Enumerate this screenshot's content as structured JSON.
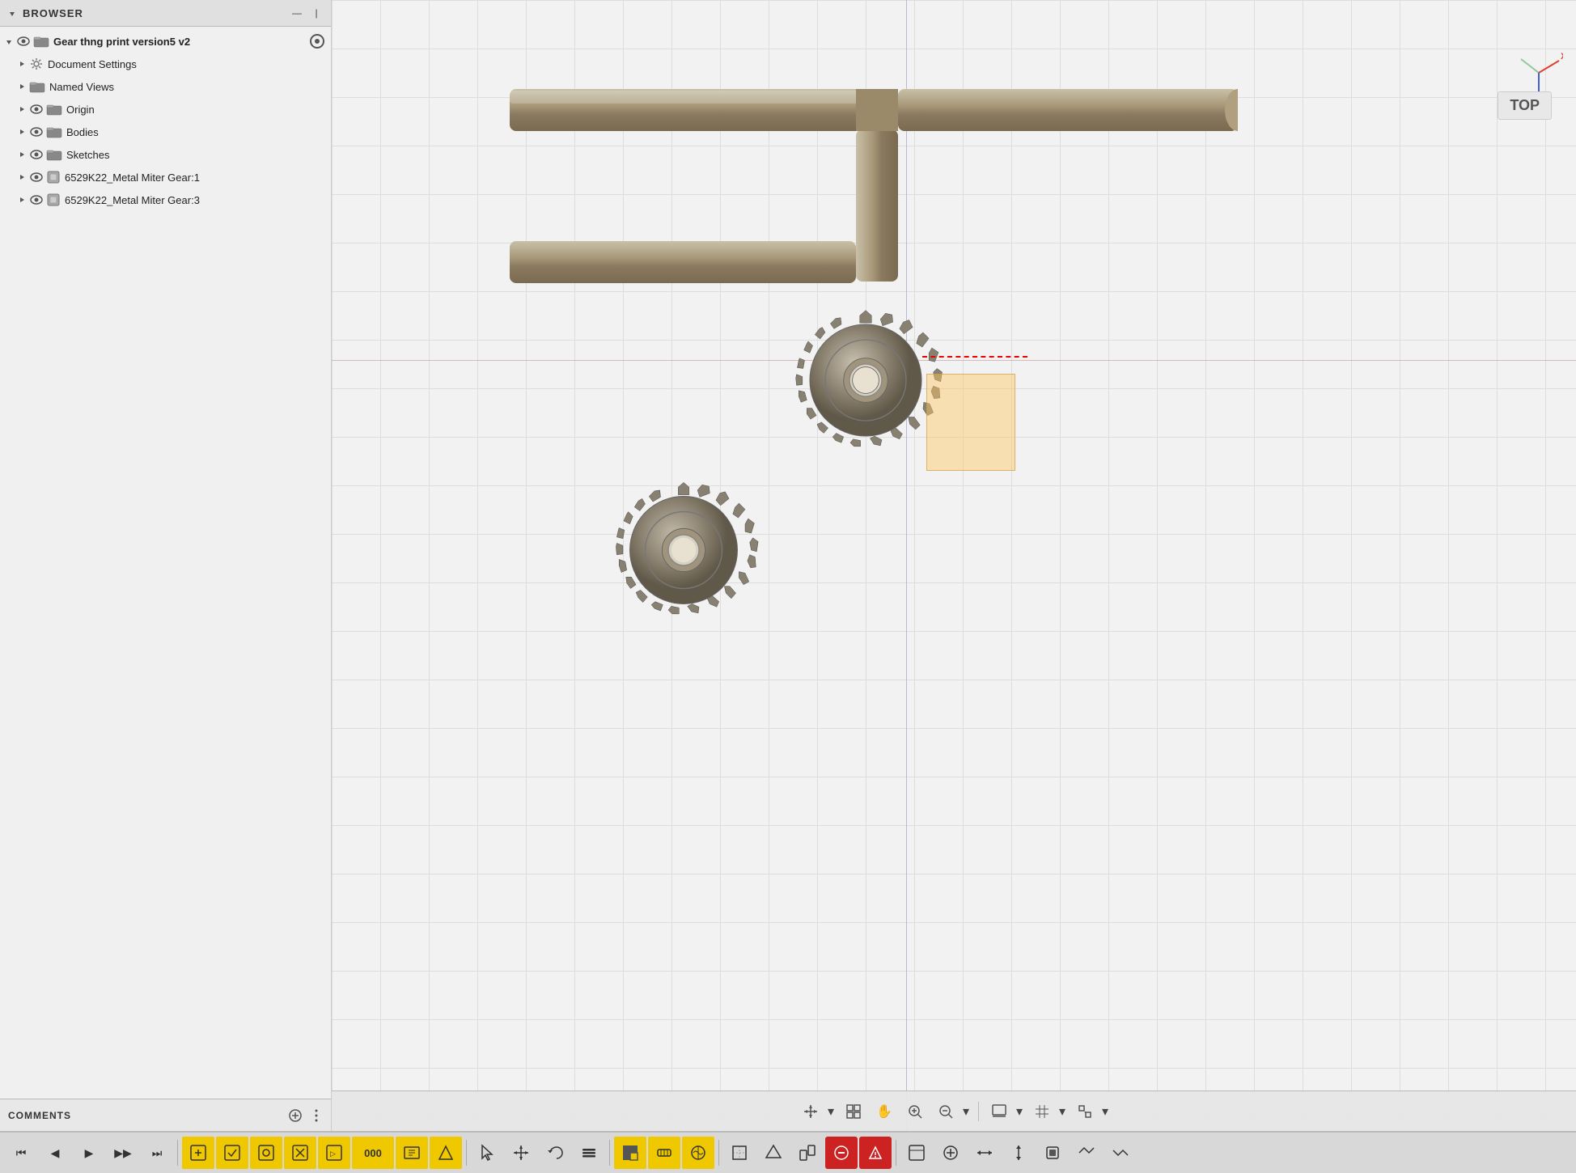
{
  "sidebar": {
    "title": "BROWSER",
    "items": [
      {
        "id": "root",
        "label": "Gear thng print version5 v2",
        "level": 0,
        "hasExpand": true,
        "expanded": true,
        "hasEye": true,
        "iconType": "component",
        "bold": true
      },
      {
        "id": "doc-settings",
        "label": "Document Settings",
        "level": 1,
        "hasExpand": true,
        "expanded": false,
        "hasEye": false,
        "iconType": "gear"
      },
      {
        "id": "named-views",
        "label": "Named Views",
        "level": 1,
        "hasExpand": true,
        "expanded": false,
        "hasEye": false,
        "iconType": "folder"
      },
      {
        "id": "origin",
        "label": "Origin",
        "level": 1,
        "hasExpand": true,
        "expanded": false,
        "hasEye": true,
        "iconType": "folder"
      },
      {
        "id": "bodies",
        "label": "Bodies",
        "level": 1,
        "hasExpand": true,
        "expanded": false,
        "hasEye": true,
        "iconType": "folder"
      },
      {
        "id": "sketches",
        "label": "Sketches",
        "level": 1,
        "hasExpand": true,
        "expanded": false,
        "hasEye": true,
        "iconType": "folder"
      },
      {
        "id": "gear1",
        "label": "6529K22_Metal Miter Gear:1",
        "level": 1,
        "hasExpand": true,
        "expanded": false,
        "hasEye": true,
        "iconType": "component-box"
      },
      {
        "id": "gear3",
        "label": "6529K22_Metal Miter Gear:3",
        "level": 1,
        "hasExpand": true,
        "expanded": false,
        "hasEye": true,
        "iconType": "component-box"
      }
    ]
  },
  "comments": {
    "label": "COMMENTS"
  },
  "viewport": {
    "view_label": "TOP"
  },
  "viewport_toolbar": {
    "buttons": [
      "↕",
      "⊞",
      "✋",
      "🔍",
      "🔎",
      "🖥",
      "▦",
      "▪"
    ]
  },
  "bottom_toolbar": {
    "buttons": [
      {
        "label": "⏮",
        "yellow": false
      },
      {
        "label": "◀",
        "yellow": false
      },
      {
        "label": "▶",
        "yellow": false
      },
      {
        "label": "▶▶",
        "yellow": false
      },
      {
        "label": "⏭",
        "yellow": false
      },
      {
        "label": "⬜",
        "yellow": true
      },
      {
        "label": "⬜",
        "yellow": true
      },
      {
        "label": "⬜",
        "yellow": true
      },
      {
        "label": "⬜",
        "yellow": true
      },
      {
        "label": "⬜",
        "yellow": true
      },
      {
        "label": "000",
        "yellow": true
      },
      {
        "label": "⬜",
        "yellow": true
      },
      {
        "label": "⬜",
        "yellow": true
      },
      {
        "label": "↔",
        "yellow": false
      },
      {
        "label": "⬜",
        "yellow": false
      },
      {
        "label": "⬜",
        "yellow": false
      },
      {
        "label": "↩",
        "yellow": false
      },
      {
        "label": "⬜",
        "yellow": false
      },
      {
        "label": "⬜",
        "yellow": true
      },
      {
        "label": "⬜",
        "yellow": true
      },
      {
        "label": "⬜",
        "yellow": true
      },
      {
        "label": "⬜",
        "yellow": false
      },
      {
        "label": "⬜",
        "yellow": false
      },
      {
        "label": "⬜",
        "yellow": false
      },
      {
        "label": "🔴",
        "yellow": false,
        "red": true
      },
      {
        "label": "🔴",
        "yellow": false,
        "red": true
      },
      {
        "label": "⬜",
        "yellow": false
      },
      {
        "label": "⬜",
        "yellow": false
      },
      {
        "label": "⬜",
        "yellow": false
      },
      {
        "label": "↔",
        "yellow": false
      },
      {
        "label": "↕",
        "yellow": false
      },
      {
        "label": "⬜",
        "yellow": false
      },
      {
        "label": "⬛",
        "yellow": false
      },
      {
        "label": "↔",
        "yellow": false
      },
      {
        "label": "↕",
        "yellow": false
      }
    ]
  }
}
